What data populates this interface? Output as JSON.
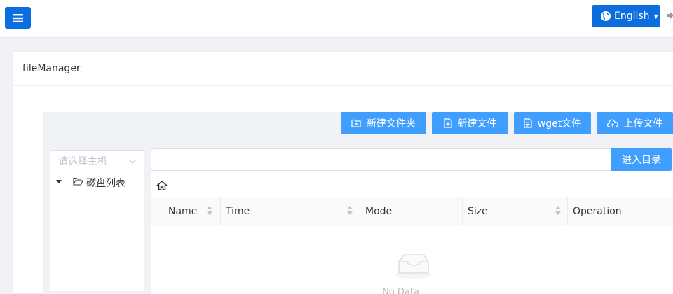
{
  "header": {
    "language_label": "English",
    "colors": {
      "primary": "#0c6dde",
      "accent": "#409eff"
    }
  },
  "card": {
    "title": "fileManager"
  },
  "toolbar": {
    "new_folder": "新建文件夹",
    "new_file": "新建文件",
    "wget_file": "wget文件",
    "upload_file": "上传文件"
  },
  "sidebar": {
    "host_placeholder": "请选择主机",
    "tree_root": "磁盘列表"
  },
  "path_bar": {
    "value": "",
    "enter_label": "进入目录"
  },
  "table": {
    "columns": [
      "Name",
      "Time",
      "Mode",
      "Size",
      "Operation"
    ],
    "rows": [],
    "empty_text": "No Data"
  }
}
